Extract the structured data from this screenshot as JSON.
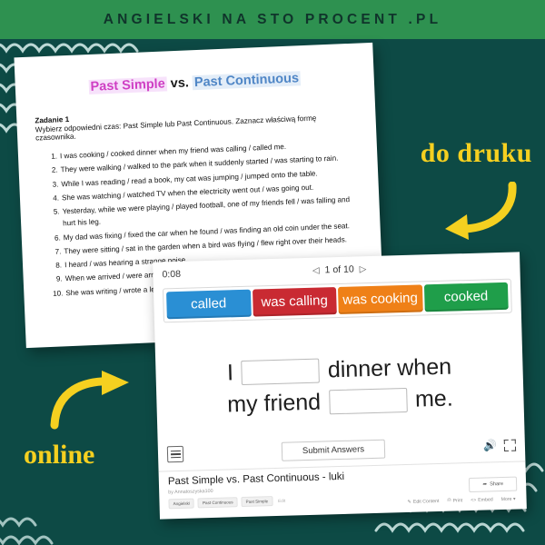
{
  "brand": {
    "title": "ANGIELSKI NA STO PROCENT .PL"
  },
  "colors": {
    "header_green": "#2e9150",
    "background_teal": "#0d4a45",
    "accent_yellow": "#f5d020",
    "chip_blue": "#2a8fd4",
    "chip_red": "#c92a32",
    "chip_orange": "#ef8017",
    "chip_green": "#1f9e4a",
    "title_pink": "#cf3fc4",
    "title_blue": "#4f86c6"
  },
  "worksheet": {
    "title_part1": "Past Simple",
    "title_vs": " vs. ",
    "title_part2": "Past Continuous",
    "task_label": "Zadanie 1",
    "instruction": "Wybierz odpowiedni czas: Past Simple lub Past Continuous. Zaznacz właściwą formę czasownika.",
    "items": [
      {
        "num": "1.",
        "text": "I was cooking / cooked dinner when my friend was calling / called me."
      },
      {
        "num": "2.",
        "text": "They were walking / walked to the park when it suddenly started / was starting to rain."
      },
      {
        "num": "3.",
        "text": "While I was reading / read a book, my cat was jumping / jumped onto the table."
      },
      {
        "num": "4.",
        "text": "She was watching / watched TV when the electricity went out / was going out."
      },
      {
        "num": "5.",
        "text": "Yesterday, while we were playing / played football, one of my friends fell / was falling and hurt his leg."
      },
      {
        "num": "6.",
        "text": "My dad was fixing / fixed the car when he found / was finding an old coin under the seat."
      },
      {
        "num": "7.",
        "text": "They were sitting / sat in the garden when a bird was flying / flew right over their heads."
      },
      {
        "num": "8.",
        "text": "I heard / was hearing a strange noise."
      },
      {
        "num": "9.",
        "text": "When we arrived / were arriving home."
      },
      {
        "num": "10.",
        "text": "She was writing / wrote a letter when the news surprised her."
      }
    ]
  },
  "quiz": {
    "timer": "0:08",
    "pager_prev": "◁",
    "pager_label": "1 of 10",
    "pager_next": "▷",
    "wordbank": [
      {
        "label": "called",
        "color": "#2a8fd4"
      },
      {
        "label": "was calling",
        "color": "#c92a32"
      },
      {
        "label": "was cooking",
        "color": "#ef8017"
      },
      {
        "label": "cooked",
        "color": "#1f9e4a"
      }
    ],
    "sentence": {
      "line1_before": "I",
      "line1_after": "dinner when",
      "line2_before": "my friend",
      "line2_after": "me."
    },
    "submit_label": "Submit Answers",
    "speaker_icon": "🔊",
    "meta": {
      "title": "Past Simple vs. Past Continuous - luki",
      "author": "by Annatoszyska100",
      "tags": [
        "Angielski",
        "Past Continuous",
        "Past Simple"
      ],
      "edit_tag_label": "Edit",
      "share_label": "Share",
      "actions": [
        {
          "label": "Edit Content",
          "icon": "✎"
        },
        {
          "label": "Print",
          "icon": "⎙"
        },
        {
          "label": "Embed",
          "icon": "<>"
        },
        {
          "label": "More ▾",
          "icon": ""
        }
      ]
    }
  },
  "annotations": {
    "print_label": "do druku",
    "online_label": "online"
  }
}
